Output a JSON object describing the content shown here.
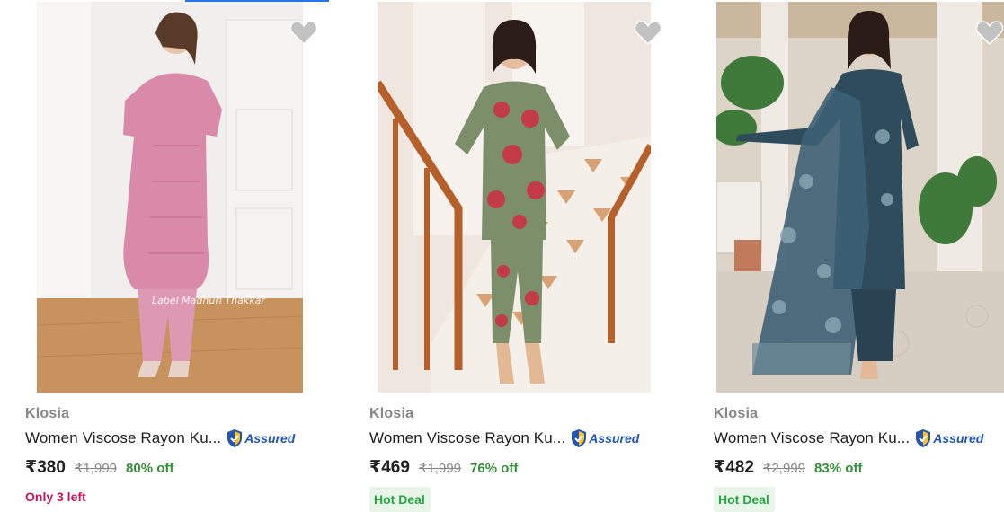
{
  "products": [
    {
      "brand": "Klosia",
      "title": "Women Viscose Rayon Ku...",
      "assured_label": "Assured",
      "price": "₹380",
      "mrp": "₹1,999",
      "discount": "80% off",
      "stock_note": "Only 3 left",
      "image_watermark": "Label Madhuri Thakkar",
      "colors": {
        "kurta": "#d98aa9",
        "background": "#f3f0ee",
        "floor": "#c99565"
      }
    },
    {
      "brand": "Klosia",
      "title": "Women Viscose Rayon Ku...",
      "assured_label": "Assured",
      "price": "₹469",
      "mrp": "₹1,999",
      "discount": "76% off",
      "deal_badge": "Hot Deal",
      "colors": {
        "kurta": "#7c8f6a",
        "background": "#efe6df",
        "floor": "#f2eee9"
      }
    },
    {
      "brand": "Klosia",
      "title": "Women Viscose Rayon Ku...",
      "assured_label": "Assured",
      "price": "₹482",
      "mrp": "₹2,999",
      "discount": "83% off",
      "deal_badge": "Hot Deal",
      "colors": {
        "kurta": "#2e4c5c",
        "background": "#ddd4c8",
        "floor": "#cfc5bb"
      }
    }
  ],
  "icons": {
    "wishlist": "heart-icon",
    "assured": "shield-check-icon"
  },
  "accent_colors": {
    "assured_blue": "#2455b3",
    "discount_green": "#388e3c",
    "stock_pink": "#c2185b",
    "deal_bg": "#e7f6e9",
    "deal_text": "#26a541"
  }
}
